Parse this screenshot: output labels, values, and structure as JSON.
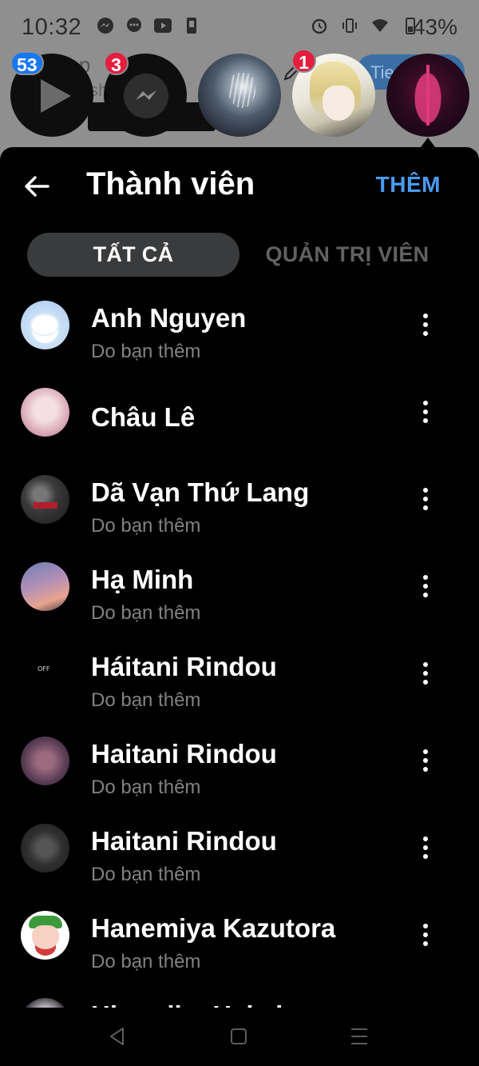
{
  "status_bar": {
    "time": "10:32",
    "battery": "43%",
    "app_icons": [
      "messenger-icon",
      "chat-bubble-icon",
      "youtube-icon",
      "sim-icon"
    ],
    "system_icons": [
      "alarm-icon",
      "vibrate-icon",
      "wifi-icon",
      "battery-icon"
    ]
  },
  "background": {
    "title_fragment": "hap",
    "subtitle_fragment": "sh",
    "button_fragment": "Tie",
    "badges": {
      "play": "53",
      "messenger": "3",
      "anime_avatar": "1"
    }
  },
  "sheet": {
    "title": "Thành viên",
    "add_label": "THÊM",
    "tabs": {
      "all": "TẤT CẢ",
      "admins": "QUẢN TRỊ VIÊN"
    },
    "active_tab": "all",
    "members": [
      {
        "name": "Anh Nguyen",
        "subtitle": "Do bạn thêm"
      },
      {
        "name": "Châu Lê",
        "subtitle": ""
      },
      {
        "name": "Dã Vạn Thứ Lang",
        "subtitle": "Do bạn thêm"
      },
      {
        "name": "Hạ Minh",
        "subtitle": "Do bạn thêm"
      },
      {
        "name": "Háitani Rindou",
        "subtitle": "Do bạn thêm"
      },
      {
        "name": "Haitani Rindou",
        "subtitle": "Do bạn thêm"
      },
      {
        "name": "Haitani Rindou",
        "subtitle": "Do bạn thêm"
      },
      {
        "name": "Hanemiya Kazutora",
        "subtitle": "Do bạn thêm"
      },
      {
        "name": "Hirumiko Hakai",
        "subtitle": ""
      }
    ]
  },
  "colors": {
    "accent": "#4a9bf0",
    "active_tab_bg": "#3a3b3c",
    "subtitle": "#828282",
    "badge_blue": "#1877f2",
    "badge_red": "#e41e3f"
  }
}
